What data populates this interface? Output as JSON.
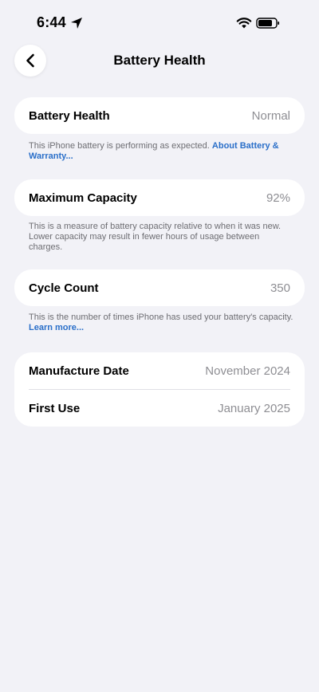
{
  "status_bar": {
    "time": "6:44",
    "icons": [
      "location-arrow-icon",
      "wifi-icon",
      "battery-icon"
    ]
  },
  "nav": {
    "title": "Battery Health",
    "back_icon": "chevron-left-icon"
  },
  "battery_health": {
    "label": "Battery Health",
    "value": "Normal",
    "footnote": "This iPhone battery is performing as expected. ",
    "link": "About Battery & Warranty..."
  },
  "maximum_capacity": {
    "label": "Maximum Capacity",
    "value": "92%",
    "footnote": "This is a measure of battery capacity relative to when it was new. Lower capacity may result in fewer hours of usage between charges."
  },
  "cycle_count": {
    "label": "Cycle Count",
    "value": "350",
    "footnote": "This is the number of times iPhone has used your battery's capacity. ",
    "link": "Learn more..."
  },
  "dates": {
    "manufacture_label": "Manufacture Date",
    "manufacture_value": "November 2024",
    "first_use_label": "First Use",
    "first_use_value": "January 2025"
  },
  "colors": {
    "background": "#f2f2f7",
    "link": "#2a6fc9",
    "secondary_text": "#8e8e93"
  }
}
